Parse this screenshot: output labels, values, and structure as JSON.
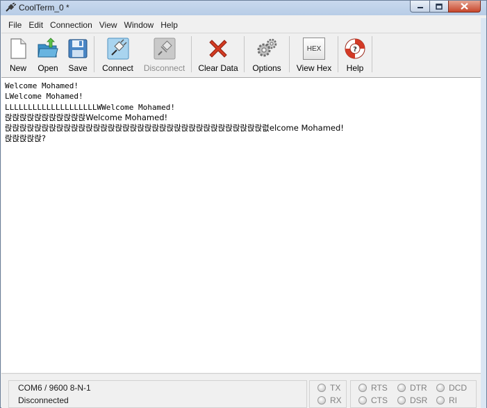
{
  "window": {
    "title": "CoolTerm_0 *"
  },
  "menu": [
    {
      "label": "File"
    },
    {
      "label": "Edit"
    },
    {
      "label": "Connection"
    },
    {
      "label": "View"
    },
    {
      "label": "Window"
    },
    {
      "label": "Help"
    }
  ],
  "toolbar": {
    "new_label": "New",
    "open_label": "Open",
    "save_label": "Save",
    "connect_label": "Connect",
    "disconnect_label": "Disconnect",
    "clear_label": "Clear Data",
    "options_label": "Options",
    "viewhex_label": "View Hex",
    "viewhex_icon_text": "HEX",
    "help_label": "Help"
  },
  "terminal": {
    "lines": [
      "Welcome Mohamed!",
      "LWelcome Mohamed!",
      "LLLLLLLLLLLLLLLLLLLLWWelcome Mohamed!",
      "랁랁랁랁랁랁랁랁랁랁랁Welcome Mohamed!",
      "랁랁랁랁랁랁랁랁랁랁랁랁랁랁랁랁랁랁랁랁랁랁랁랁랁랁랁랁랁랁랁랁랁랁랁렶elcome Mohamed!",
      "랁랁랁랁랁?"
    ]
  },
  "status": {
    "port": "COM6 / 9600 8-N-1",
    "connection": "Disconnected",
    "leds": {
      "tx": "TX",
      "rx": "RX",
      "rts": "RTS",
      "cts": "CTS",
      "dtr": "DTR",
      "dsr": "DSR",
      "dcd": "DCD",
      "ri": "RI"
    }
  },
  "colors": {
    "close_button": "#c7472c",
    "titlebar": "#b7cce6",
    "clear_icon": "#d23b22",
    "connect_icon_bg": "#a9d4ef"
  }
}
